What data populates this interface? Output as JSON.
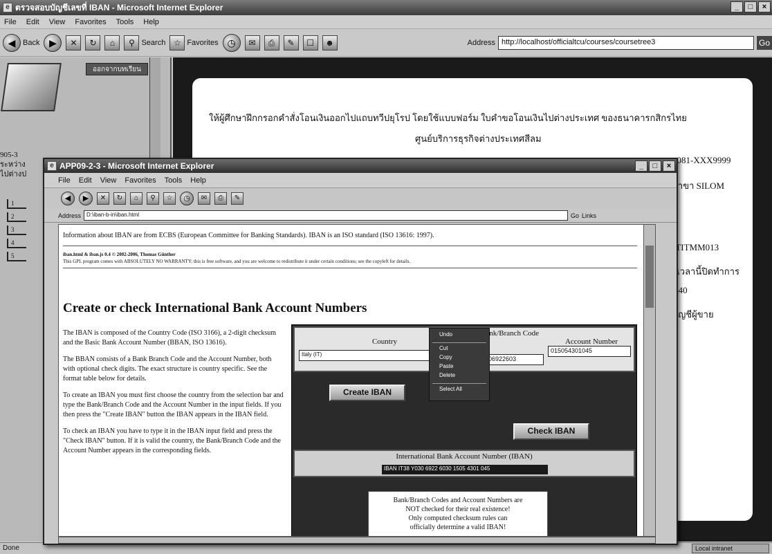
{
  "outer": {
    "title": "ตรวจสอบบัญชีเลขที่ IBAN - Microsoft Internet Explorer",
    "menu": [
      "File",
      "Edit",
      "View",
      "Favorites",
      "Tools",
      "Help"
    ],
    "toolbar": {
      "back": "Back",
      "search": "Search",
      "favorites": "Favorites",
      "address_label": "Address"
    },
    "address": "http://localhost/officialtcu/courses/coursetree3",
    "go": "Go",
    "status": "Done",
    "status_zone": "Local intranet"
  },
  "left_panel": {
    "header_button": "ออกจากบทเรียน",
    "thai_lines": [
      "905-3",
      "ระหว่าง",
      "ไปต่างป"
    ],
    "icon_labels": [
      "1",
      "2",
      "3",
      "4",
      "5"
    ]
  },
  "background": {
    "instruction": "ให้ผู้ศึกษาฝึกกรอกคำสั่งโอนเงินออกไปแถบทวีปยุโรป โดยใช้แบบฟอร์ม ใบคำขอโอนเงินไปต่างประเทศ ของธนาคารกสิกรไทย",
    "center": "ศูนย์บริการธุรกิจต่างประเทศสีลม",
    "right": [
      ", 081-XXX9999",
      "สาขา SILOM",
      "ITITMM013",
      "งเวลานี้ปิดทำการ",
      "R40",
      "บัญชีผู้ขาย"
    ]
  },
  "popup": {
    "title": "APP09-2-3 - Microsoft Internet Explorer",
    "menu": [
      "File",
      "Edit",
      "View",
      "Favorites",
      "Tools",
      "Help"
    ],
    "address_label": "Address",
    "address": "D:\\iban-b-in\\iban.html",
    "go": "Go",
    "links": "Links",
    "info": "Information about IBAN are from ECBS (European Committee for Banking Standards). IBAN is an ISO standard (ISO 13616: 1997).",
    "credit_line1": "iban.html & iban.js 0.4 © 2002-2006, Thomas Günther",
    "credit_line2": "This GPL program comes with ABSOLUTELY NO WARRANTY; this is free software, and you are welcome to redistribute it under certain conditions; see the copyleft for details.",
    "heading": "Create or check International Bank Account Numbers",
    "paragraphs": [
      "The IBAN is composed of the Country Code (ISO 3166), a 2-digit checksum and the Basic Bank Account Number (BBAN, ISO 13616).",
      "The BBAN consists of a Bank Branch Code and the Account Number, both with optional check digits. The exact structure is country specific. See the format table below for details.",
      "To create an IBAN you must first choose the country from the selection bar and type the Bank/Branch Code and the Account Number in the input fields. If you then press the \"Create IBAN\" button the IBAN appears in the IBAN field.",
      "To check an IBAN you have to type it in the IBAN input field and press the \"Check IBAN\" button. If it is valid the country, the Bank/Branch Code and the Account Number appears in the corresponding fields."
    ],
    "form": {
      "country_label": "Country",
      "bank_label": "Bank/Branch Code",
      "account_label": "Account Number",
      "country_value": "Italy (IT)",
      "bank_value": "Y0306922603",
      "account_value": "015054301045",
      "create_button": "Create IBAN",
      "check_button": "Check IBAN",
      "iban_title": "International Bank Account Number (IBAN)",
      "iban_value": "IBAN IT38 Y030 6922 6030 1505 4301 045",
      "note": [
        "Bank/Branch Codes and Account Numbers are",
        "NOT checked for their real existence!",
        "Only computed checksum rules can",
        "officially determine a valid IBAN!"
      ]
    },
    "context_menu": [
      "Undo",
      "Cut",
      "Copy",
      "Paste",
      "Delete",
      "Select All"
    ]
  }
}
